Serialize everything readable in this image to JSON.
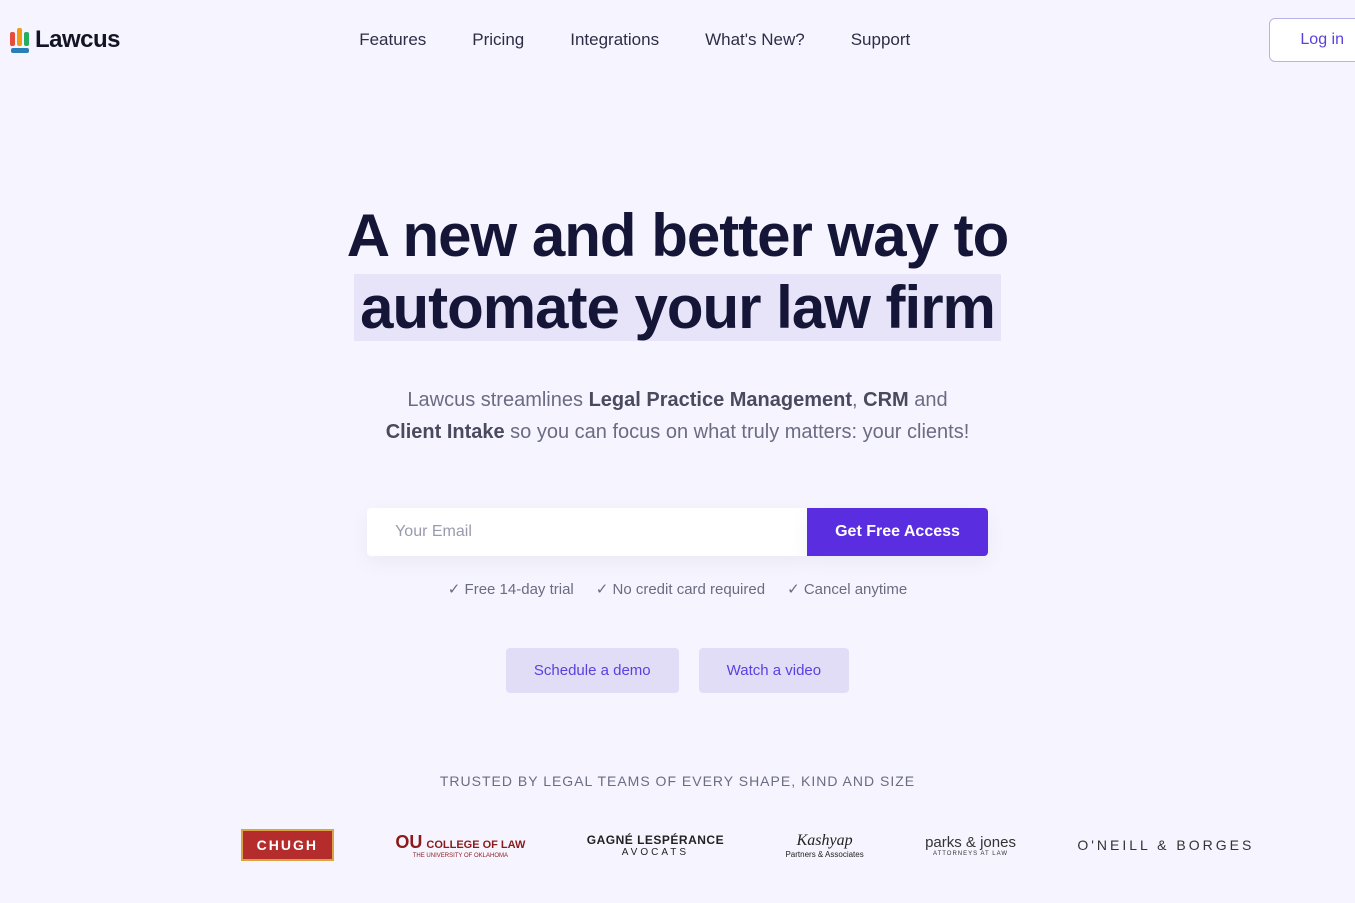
{
  "brand": {
    "name": "Lawcus"
  },
  "nav": {
    "items": [
      {
        "label": "Features"
      },
      {
        "label": "Pricing"
      },
      {
        "label": "Integrations"
      },
      {
        "label": "What's New?"
      },
      {
        "label": "Support"
      }
    ],
    "login": "Log in"
  },
  "hero": {
    "title_line1": "A new and better way to",
    "title_line2": "automate your law firm",
    "subtitle_pre": "Lawcus streamlines ",
    "subtitle_bold1": "Legal Practice Management",
    "subtitle_mid1": ", ",
    "subtitle_bold2": "CRM",
    "subtitle_mid2": " and",
    "subtitle_bold3": "Client Intake",
    "subtitle_end": " so you can focus on what truly matters: your clients!"
  },
  "form": {
    "placeholder": "Your Email",
    "cta": "Get Free Access"
  },
  "perks": [
    "Free 14-day trial",
    "No credit card required",
    "Cancel anytime"
  ],
  "secondary": {
    "demo": "Schedule a demo",
    "video": "Watch a video"
  },
  "trusted": {
    "heading": "TRUSTED BY LEGAL TEAMS OF EVERY SHAPE, KIND AND SIZE",
    "clients": {
      "chugh": "CHUGH",
      "college": "COLLEGE OF LAW",
      "college_sub": "THE UNIVERSITY OF OKLAHOMA",
      "gagne": "GAGNÉ LESPÉRANCE",
      "gagne_sub": "AVOCATS",
      "kashyap": "Kashyap",
      "kashyap_sub": "Partners & Associates",
      "parks": "parks & jones",
      "parks_sub": "ATTORNEYS AT LAW",
      "oneill": "O'NEILL & BORGES"
    }
  }
}
